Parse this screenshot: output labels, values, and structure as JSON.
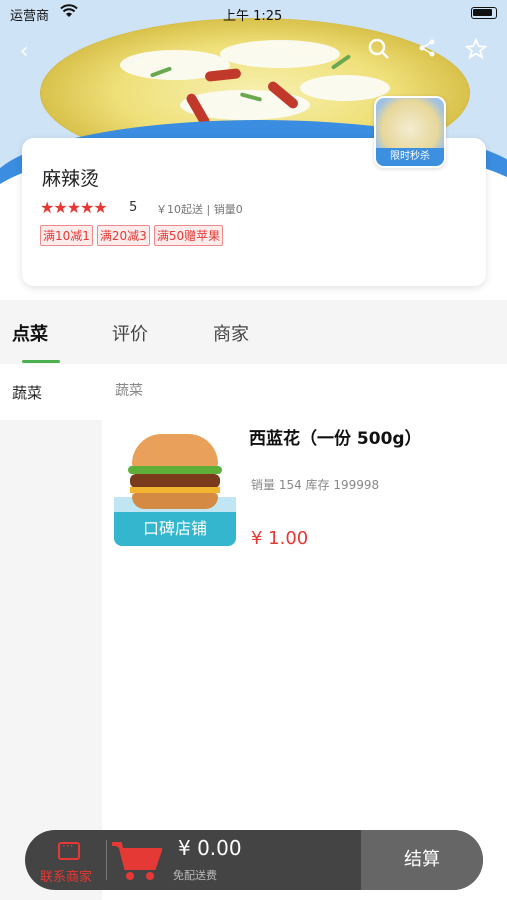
{
  "status_bar": {
    "carrier": "运营商",
    "time": "上午 1:25"
  },
  "shop": {
    "name": "麻辣烫",
    "stars": "★★★★★",
    "rating": "5",
    "delivery_info": "￥10起送 | 销量0",
    "promos": [
      "满10减1",
      "满20减3",
      "满50赠苹果"
    ],
    "flash_sale_label": "限时秒杀"
  },
  "tabs": [
    {
      "label": "点菜",
      "active": true
    },
    {
      "label": "评价",
      "active": false
    },
    {
      "label": "商家",
      "active": false
    }
  ],
  "sidebar": {
    "items": [
      {
        "label": "蔬菜",
        "active": true
      }
    ]
  },
  "category_title": "蔬菜",
  "product": {
    "image_banner": "口碑店铺",
    "name": "西蓝花（一份 500g）",
    "meta": "销量 154 库存 199998",
    "price": "¥ 1.00"
  },
  "cart": {
    "contact_label": "联系商家",
    "total": "¥ 0.00",
    "delivery_note": "免配送费",
    "checkout_label": "结算"
  },
  "colors": {
    "accent_red": "#e53935",
    "tab_green": "#4caf50",
    "hero_blue": "#3a8de0"
  },
  "icons": [
    "back-icon",
    "search-icon",
    "share-icon",
    "star-outline-icon",
    "chat-icon",
    "cart-icon",
    "wifi-icon",
    "battery-icon"
  ]
}
